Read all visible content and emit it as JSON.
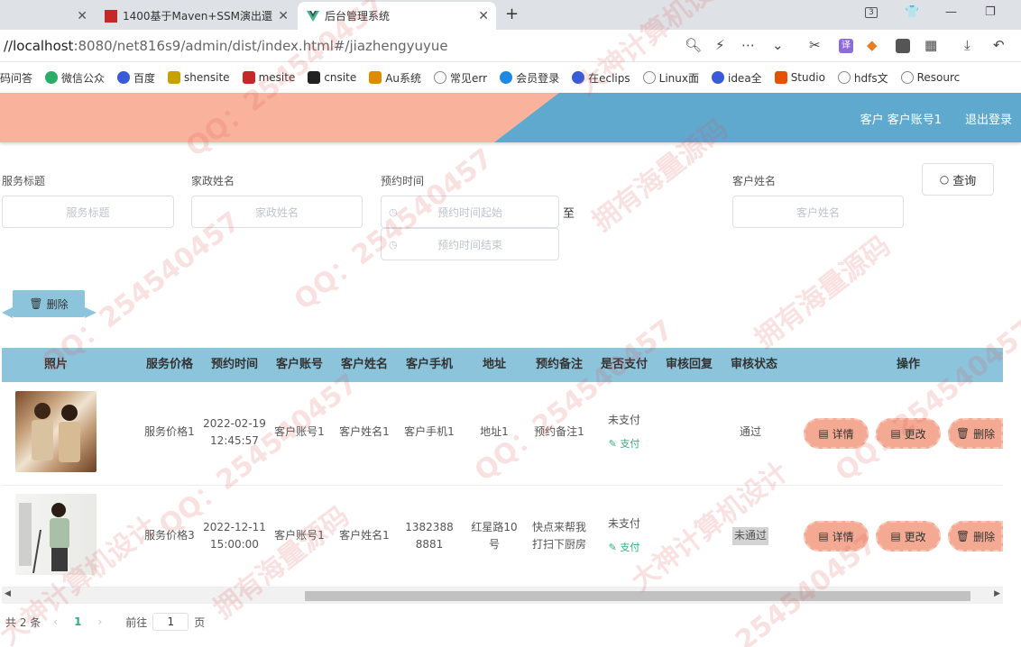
{
  "browser": {
    "tabs": [
      {
        "label": ""
      },
      {
        "label": "1400基于Maven+SSM演出還"
      },
      {
        "label": "后台管理系统"
      }
    ],
    "url_host": "//localhost",
    "url_rest": ":8080/net816s9/admin/dist/index.html#/jiazhengyuyue",
    "tab_count": "3",
    "bookmarks": [
      {
        "label": "码问答",
        "color": "#ffffff"
      },
      {
        "label": "微信公众",
        "color": "#2aae67"
      },
      {
        "label": "百度",
        "color": "#3a5bd8"
      },
      {
        "label": "shensite",
        "color": "#c8a000"
      },
      {
        "label": "mesite",
        "color": "#c62828"
      },
      {
        "label": "cnsite",
        "color": "#222222"
      },
      {
        "label": "Au系统",
        "color": "#e08a00"
      },
      {
        "label": "常见err",
        "color": "#888888"
      },
      {
        "label": "会员登录",
        "color": "#1e88e5"
      },
      {
        "label": "在eclips",
        "color": "#3a5bd8"
      },
      {
        "label": "Linux面",
        "color": "#888888"
      },
      {
        "label": "idea全",
        "color": "#3a5bd8"
      },
      {
        "label": "Studio",
        "color": "#e65100"
      },
      {
        "label": "hdfs文",
        "color": "#888888"
      },
      {
        "label": "Resourc",
        "color": "#888888"
      }
    ]
  },
  "header": {
    "user_text": "客户 客户账号1",
    "logout": "退出登录"
  },
  "search": {
    "fields": [
      {
        "label": "服务标题",
        "placeholder": "服务标题"
      },
      {
        "label": "家政姓名",
        "placeholder": "家政姓名"
      },
      {
        "label": "预约时间",
        "placeholder_start": "预约时间起始",
        "placeholder_end": "预约时间结束"
      },
      {
        "label": "客户姓名",
        "placeholder": "客户姓名"
      }
    ],
    "range_sep": "至",
    "search_button": "查询"
  },
  "toolbar": {
    "delete_button": "删除"
  },
  "table": {
    "headers": [
      "照片",
      "服务价格",
      "预约时间",
      "客户账号",
      "客户姓名",
      "客户手机",
      "地址",
      "预约备注",
      "是否支付",
      "审核回复",
      "审核状态",
      "操作"
    ],
    "rows": [
      {
        "price": "服务价格1",
        "time": "2022-02-19 12:45:57",
        "account": "客户账号1",
        "name": "客户姓名1",
        "phone": "客户手机1",
        "address": "地址1",
        "note": "预约备注1",
        "paid": "未支付",
        "pay_link": "支付",
        "reply": "",
        "status": "通过"
      },
      {
        "price": "服务价格3",
        "time": "2022-12-11 15:00:00",
        "account": "客户账号1",
        "name": "客户姓名1",
        "phone": "13823888881",
        "address": "红星路10号",
        "note": "快点来帮我打扫下厨房",
        "paid": "未支付",
        "pay_link": "支付",
        "reply": "",
        "status": "未通过"
      }
    ],
    "actions": {
      "detail": "详情",
      "edit": "更改",
      "delete": "删除"
    }
  },
  "pagination": {
    "total": "共 2 条",
    "current_page": "1",
    "goto_label": "前往",
    "goto_value": "1",
    "page_unit": "页"
  }
}
